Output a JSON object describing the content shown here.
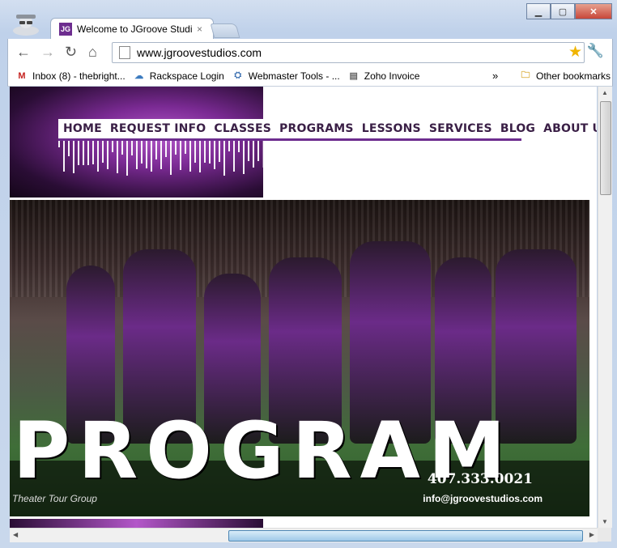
{
  "browser": {
    "tab_title": "Welcome to JGroove Studio",
    "tab_favicon": "JG",
    "tab_close": "×",
    "url": "www.jgroovestudios.com",
    "icons": [
      "back-arrow-icon",
      "forward-arrow-icon",
      "reload-icon",
      "home-icon",
      "page-icon",
      "star-icon",
      "wrench-icon",
      "incognito-icon"
    ]
  },
  "bookmarks": [
    {
      "label": "Inbox (8) - thebright...",
      "icon": "gmail-icon"
    },
    {
      "label": "Rackspace Login",
      "icon": "cloud-icon"
    },
    {
      "label": "Webmaster Tools - ...",
      "icon": "webmaster-icon"
    },
    {
      "label": "Zoho Invoice",
      "icon": "zoho-icon"
    }
  ],
  "bookmarks_more": "»",
  "other_bookmarks": "Other bookmarks",
  "site": {
    "nav": [
      {
        "label": "HOME"
      },
      {
        "label": "REQUEST INFO"
      },
      {
        "label": "CLASSES"
      },
      {
        "label": "PROGRAMS"
      },
      {
        "label": "LESSONS"
      },
      {
        "label": "SERVICES"
      },
      {
        "label": "BLOG"
      },
      {
        "label": "ABOUT US"
      }
    ],
    "hero_title": "PROGRAM",
    "phone": "407.333.0021",
    "email": "info@jgroovestudios.com",
    "caption": "Theater Tour Group"
  },
  "colors": {
    "brand_purple": "#6d2d8f",
    "nav_text": "#3a1f46",
    "star": "#f0b400"
  }
}
